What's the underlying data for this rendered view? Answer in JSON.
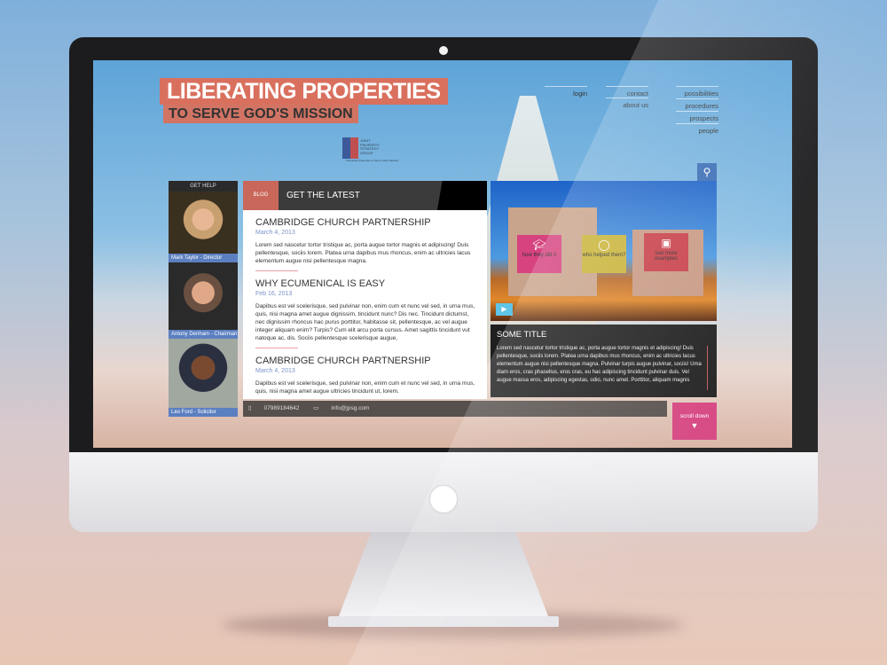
{
  "header": {
    "title": "LIBERATING PROPERTIES",
    "subtitle": "TO SERVE GOD'S MISSION"
  },
  "nav": {
    "col1": [
      "login"
    ],
    "col2": [
      "contact",
      "about us"
    ],
    "col3": [
      "possibilities",
      "procedures",
      "prospects",
      "people"
    ]
  },
  "logo": {
    "text": "JOINT PROPERTY STRATEGY GROUP",
    "tagline": "Liberating Properties to Serve God's Mission"
  },
  "search_icon": "search-icon",
  "help": {
    "heading": "GET HELP",
    "people": [
      "Mark Taylor - Director",
      "Antony Denham - Chairman",
      "Leo Ford - Solicitor"
    ]
  },
  "blog": {
    "tab": "BLOG",
    "title": "GET THE LATEST",
    "posts": [
      {
        "title": "CAMBRIDGE CHURCH PARTNERSHIP",
        "date": "March 4, 2013",
        "body": "Lorem sed nascetur tortor tristique ac, porta augue tortor magnis et adipiscing! Duis pellentesque, sociis lorem. Platea urna dapibus mus rhoncus, enim ac ultricies lacus elementum augue nisi pellentesque magna."
      },
      {
        "title": "WHY ECUMENICAL IS EASY",
        "date": "Feb 16, 2013",
        "body": "Dapibus est vel scelerisque, sed pulvinar non, enim cum et nunc vel sed, in urna mus, quis, nisi magna amet augue dignissim, tincidunt nunc? Dis nec. Tincidunt dictumst, nec dignissim rhoncus hac purus porttitor, habitasse sit, pellentesque, ac vel augue integer aliquam enim? Turpis? Cum elit arcu porta cursus. Amet sagittis tincidunt vut natoque ac, dis. Sociis pellentesque scelerisque augue,"
      },
      {
        "title": "CAMBRIDGE CHURCH PARTNERSHIP",
        "date": "March 4, 2013",
        "body": "Dapibus est vel scelerisque, sed pulvinar non, enim cum et nunc vel sed, in urna mus, quis, nisi magna amet augue ultricies tincidunt ut, lorem."
      }
    ]
  },
  "footer": {
    "phone": "07989184642",
    "email": "info@jpsg.com"
  },
  "tiles": [
    {
      "label": "how they did it",
      "color": "#d6437f"
    },
    {
      "label": "who helped them?",
      "color": "#c9b43a"
    },
    {
      "label": "see more examples",
      "color": "#c8404a"
    }
  ],
  "panel": {
    "title": "SOME TITLE",
    "body": "Lorem sed nascetur tortor tristique ac, porta augue tortor magnis et adipiscing! Duis pellentesque, sociis lorem. Platea urna dapibus mus rhoncus, enim ac ultricies lacus elementum augue nisi pellentesque magna. Pulvinar turpis augue pulvinar, sociis! Uma diam eros, cras phasellus, eros cras, eu hac adipiscing tincidunt pulvinar duis. Vel augue massa eros, adipiscing egestas, odio, nunc amet. Porttitor, aliquam magnis"
  },
  "scroll": {
    "label": "scroll down"
  }
}
